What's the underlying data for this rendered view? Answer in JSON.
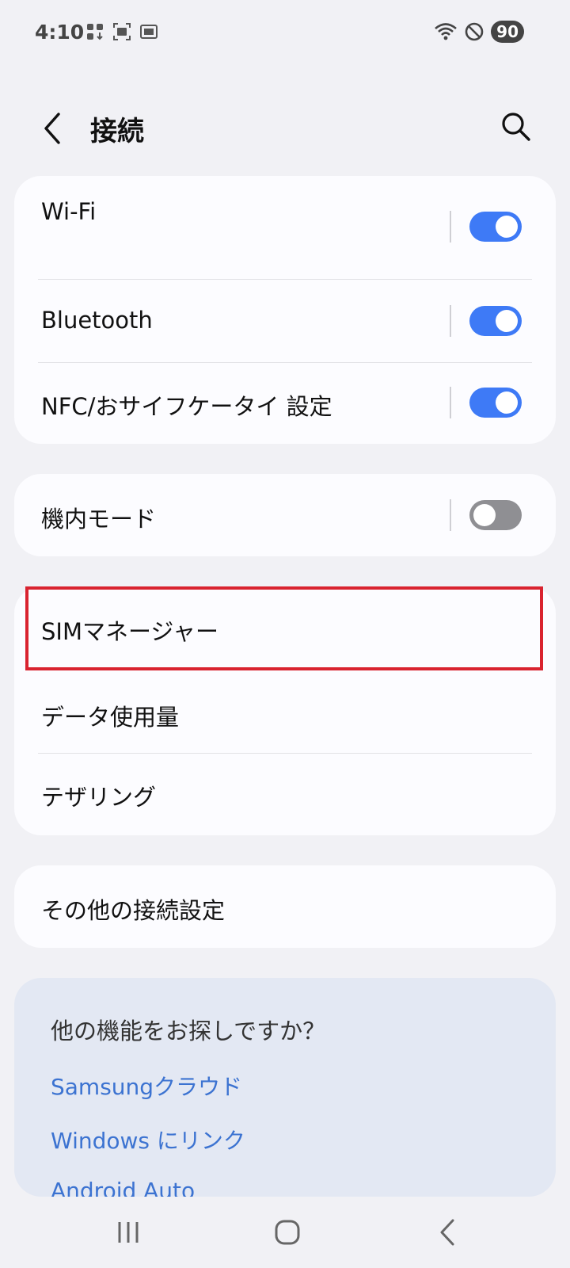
{
  "status_bar": {
    "time": "4:10",
    "battery": "90",
    "left_icons": [
      "notification-grid-icon",
      "screenshot-icon",
      "media-icon"
    ],
    "right_icons": [
      "wifi-icon",
      "do-not-disturb-icon"
    ]
  },
  "header": {
    "title": "接続",
    "back_icon": "chevron-left-icon",
    "search_icon": "search-icon"
  },
  "groups": [
    {
      "items": [
        {
          "label": "Wi-Fi",
          "toggle": "on"
        },
        {
          "label": "Bluetooth",
          "toggle": "on"
        },
        {
          "label": "NFC/おサイフケータイ 設定",
          "toggle": "on"
        }
      ]
    },
    {
      "items": [
        {
          "label": "機内モード",
          "toggle": "off"
        }
      ]
    },
    {
      "items": [
        {
          "label": "SIMマネージャー"
        },
        {
          "label": "データ使用量"
        },
        {
          "label": "テザリング"
        }
      ]
    },
    {
      "items": [
        {
          "label": "その他の接続設定"
        }
      ]
    }
  ],
  "suggestions": {
    "title": "他の機能をお探しですか？",
    "links": [
      "Samsungクラウド",
      "Windows にリンク",
      "Android Auto"
    ]
  },
  "colors": {
    "accent": "#3e7af6",
    "highlight": "#d9232f",
    "link": "#3c73d1"
  }
}
